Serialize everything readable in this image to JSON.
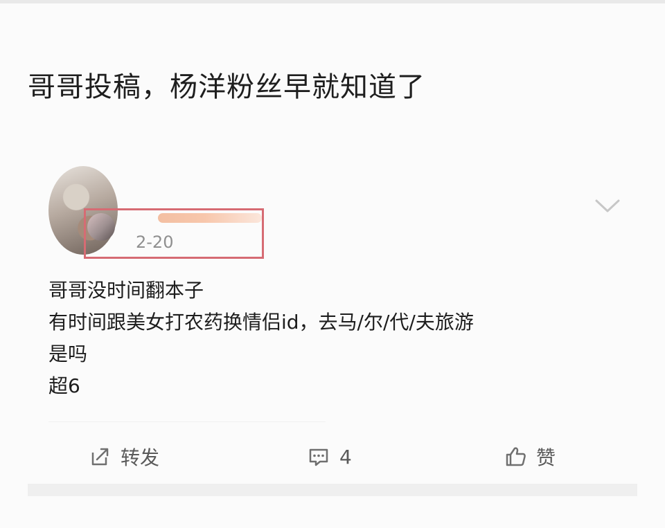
{
  "headline": "哥哥投稿，杨洋粉丝早就知道了",
  "post": {
    "date": "2-20",
    "lines": [
      "哥哥没时间翻本子",
      "有时间跟美女打农药换情侣id，去马/尔/代/夫旅游",
      "是吗",
      "超6"
    ],
    "actions": {
      "repost_label": "转发",
      "comment_count": "4",
      "like_label": "赞"
    }
  },
  "icons": {
    "more": "chevron-down-icon",
    "repost": "share-icon",
    "comment": "comment-icon",
    "like": "thumb-up-icon"
  },
  "colors": {
    "highlight_box": "#d66b73",
    "text": "#1d1d1d",
    "meta": "#8f8f8f",
    "action": "#595959"
  }
}
